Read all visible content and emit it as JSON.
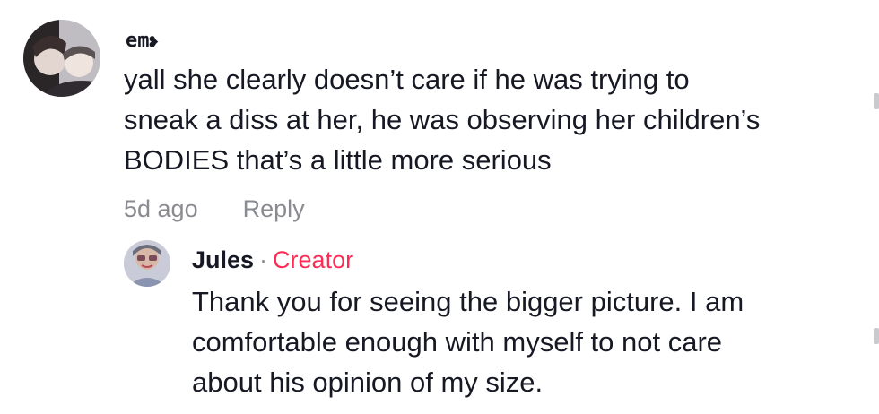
{
  "comment": {
    "username": "em",
    "username_icon": "black-heart-icon",
    "text": "yall she clearly doesn’t care if he was trying to\nsneak a diss at her, he was observing her children’s\nBODIES that’s a little more serious",
    "timestamp": "5d ago",
    "reply_label": "Reply"
  },
  "reply": {
    "username": "Jules",
    "separator": "·",
    "badge": "Creator",
    "text": "Thank you for seeing the bigger picture. I am\ncomfortable enough with myself to not care\nabout his opinion of my size."
  },
  "colors": {
    "text": "#161823",
    "secondary": "#8a8b91",
    "creator": "#fe2c55"
  }
}
